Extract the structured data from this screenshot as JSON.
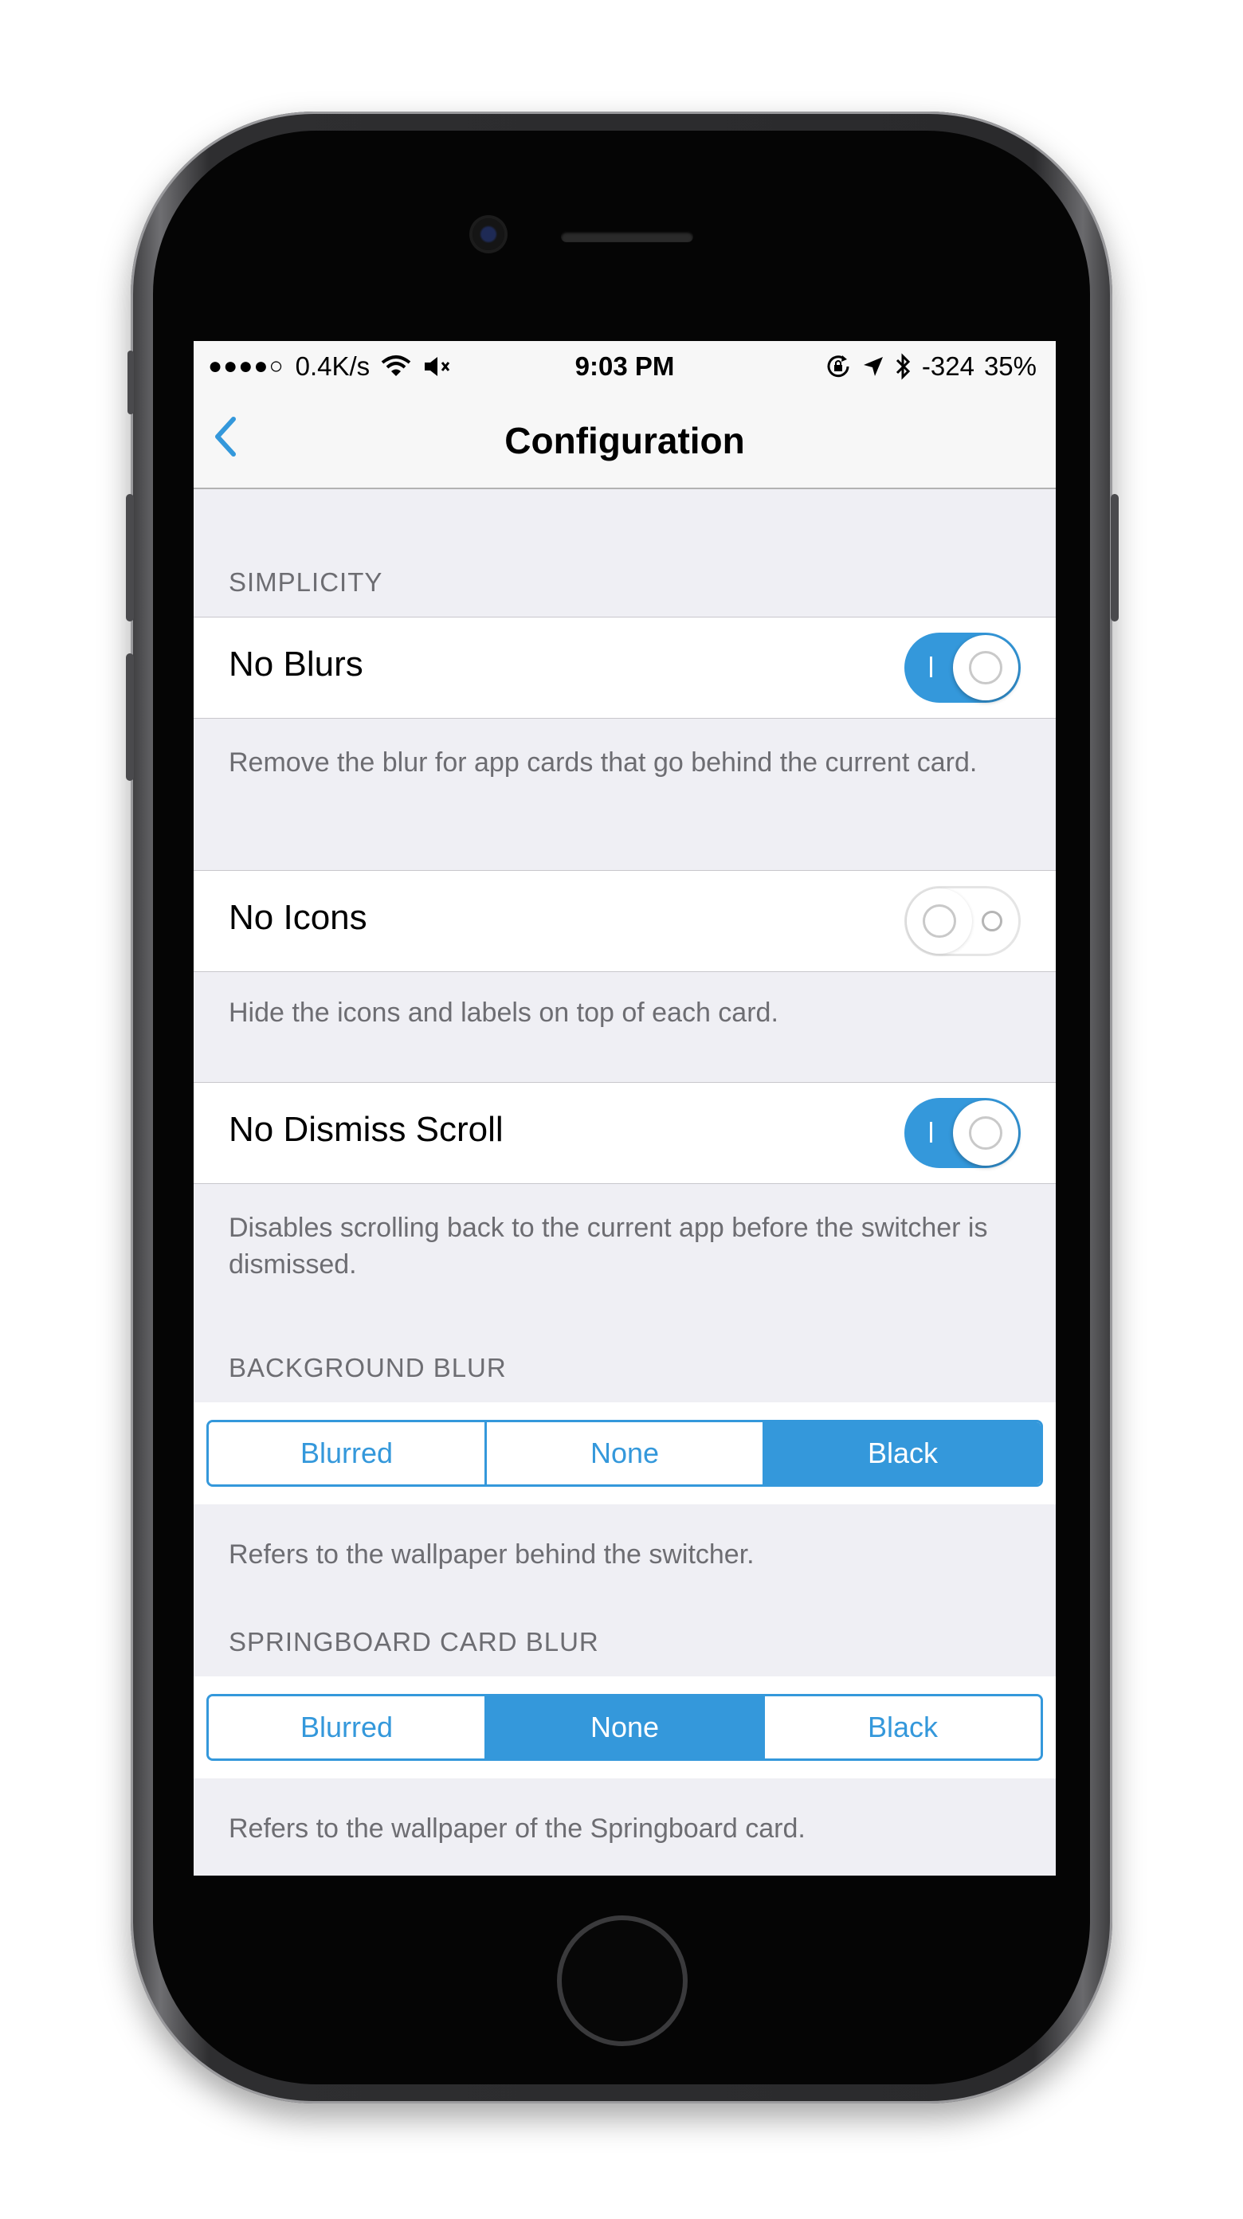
{
  "status_bar": {
    "signal": "●●●●○",
    "network_speed": "0.4K/s",
    "time": "9:03 PM",
    "signal_strength": "-324",
    "battery": "35%"
  },
  "nav": {
    "title": "Configuration"
  },
  "sections": {
    "simplicity": {
      "header": "SIMPLICITY",
      "no_blurs": {
        "label": "No Blurs",
        "enabled": true,
        "footer": "Remove the blur for app cards that go behind the current card."
      },
      "no_icons": {
        "label": "No Icons",
        "enabled": false,
        "footer": "Hide the icons and labels on top of each card."
      },
      "no_dismiss_scroll": {
        "label": "No Dismiss Scroll",
        "enabled": true,
        "footer": "Disables scrolling back to the current app before the switcher is dismissed."
      }
    },
    "background_blur": {
      "header": "BACKGROUND BLUR",
      "options": [
        "Blurred",
        "None",
        "Black"
      ],
      "selected": "Black",
      "footer": "Refers to the wallpaper behind the switcher."
    },
    "springboard_card_blur": {
      "header": "SPRINGBOARD CARD BLUR",
      "options": [
        "Blurred",
        "None",
        "Black"
      ],
      "selected": "None",
      "footer": "Refers to the wallpaper of the Springboard card."
    }
  },
  "colors": {
    "accent": "#3498db",
    "background": "#efeff4",
    "secondary_text": "#6d6d72"
  }
}
